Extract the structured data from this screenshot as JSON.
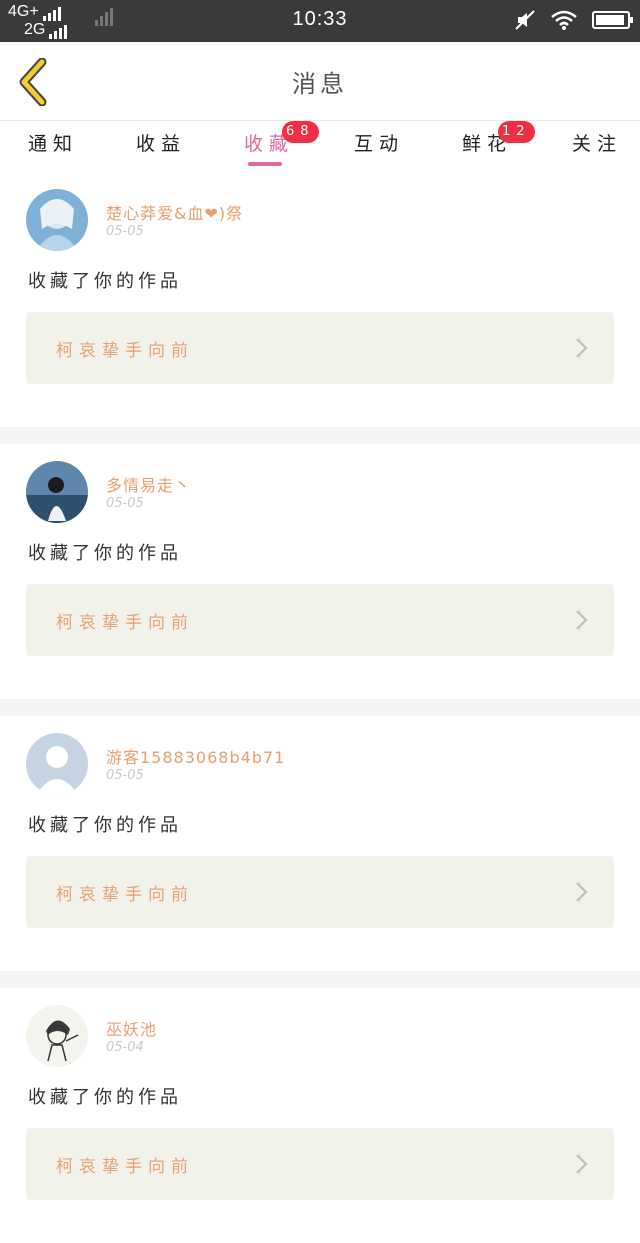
{
  "status_bar": {
    "network_top": "4G+",
    "network_bottom": "2G",
    "time": "10:33"
  },
  "header": {
    "title": "消息"
  },
  "tabs": [
    {
      "label": "通知"
    },
    {
      "label": "收益"
    },
    {
      "label": "收藏",
      "badge": "68",
      "active": true
    },
    {
      "label": "互动"
    },
    {
      "label": "鲜花",
      "badge": "12"
    },
    {
      "label": "关注"
    }
  ],
  "messages": [
    {
      "username": "楚心莽爱&血❤)祭",
      "date": "05-05",
      "action": "收藏了你的作品",
      "work_title": "柯哀挚手向前"
    },
    {
      "username": "多情易走丶",
      "date": "05-05",
      "action": "收藏了你的作品",
      "work_title": "柯哀挚手向前"
    },
    {
      "username": "游客15883068b4b71",
      "date": "05-05",
      "action": "收藏了你的作品",
      "work_title": "柯哀挚手向前"
    },
    {
      "username": "巫妖池",
      "date": "05-04",
      "action": "收藏了你的作品",
      "work_title": "柯哀挚手向前"
    }
  ],
  "colors": {
    "accent": "#e06aa0",
    "badge": "#ee3042",
    "username": "#e8a070",
    "work_bg": "#f2f2ea",
    "back_arrow": "#f2cc33"
  },
  "icons": [
    "back-arrow-icon",
    "mute-icon",
    "wifi-icon",
    "battery-icon",
    "chevron-right-icon",
    "avatar"
  ]
}
